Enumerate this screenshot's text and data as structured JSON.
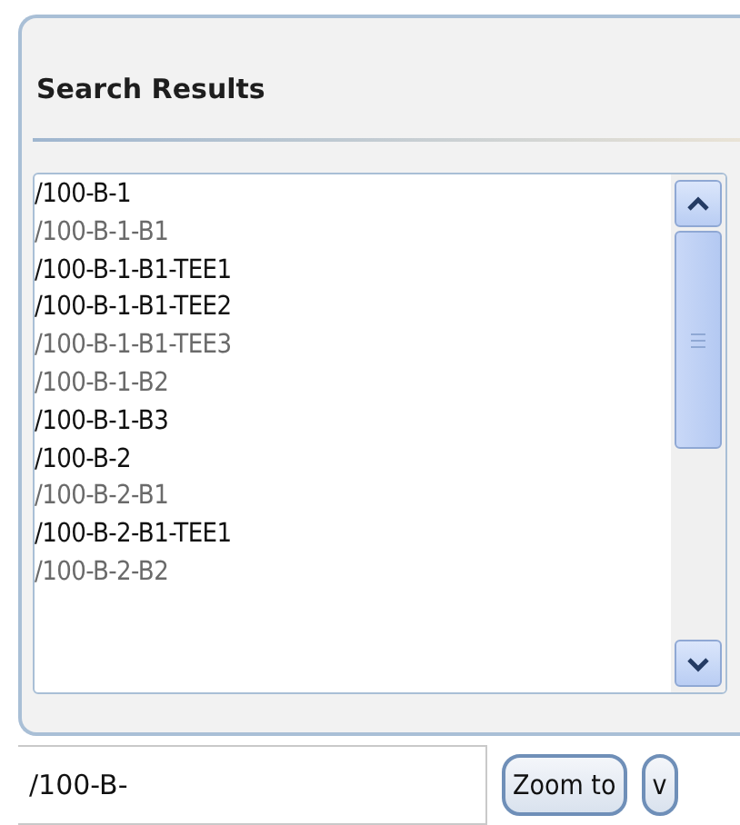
{
  "panel": {
    "title": "Search Results"
  },
  "results": [
    {
      "label": "/100-B-1",
      "dimmed": false
    },
    {
      "label": "/100-B-1-B1",
      "dimmed": true
    },
    {
      "label": "/100-B-1-B1-TEE1",
      "dimmed": false
    },
    {
      "label": "/100-B-1-B1-TEE2",
      "dimmed": false
    },
    {
      "label": "/100-B-1-B1-TEE3",
      "dimmed": true
    },
    {
      "label": "/100-B-1-B2",
      "dimmed": true
    },
    {
      "label": "/100-B-1-B3",
      "dimmed": false
    },
    {
      "label": "/100-B-2",
      "dimmed": false
    },
    {
      "label": "/100-B-2-B1",
      "dimmed": true
    },
    {
      "label": "/100-B-2-B1-TEE1",
      "dimmed": false
    },
    {
      "label": "/100-B-2-B2",
      "dimmed": true
    }
  ],
  "search": {
    "value": "/100-B-"
  },
  "buttons": [
    {
      "label": "Zoom to"
    },
    {
      "label": "v"
    }
  ]
}
